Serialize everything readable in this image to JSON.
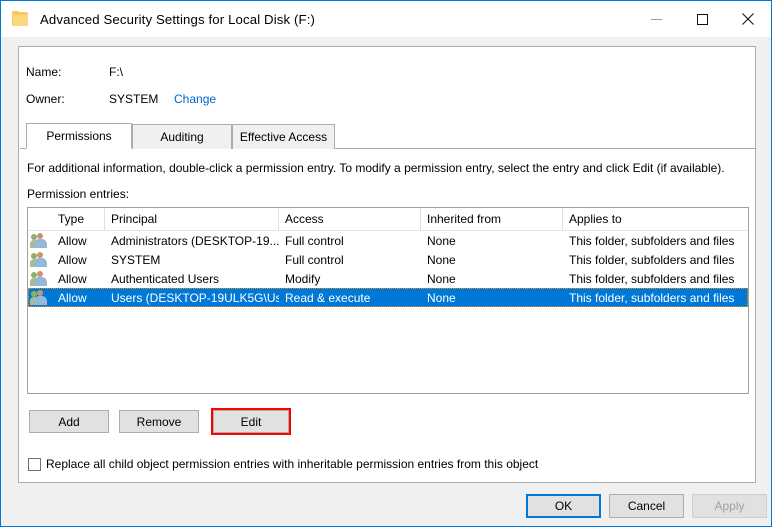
{
  "window": {
    "title": "Advanced Security Settings for Local Disk (F:)",
    "icon": "folder-icon",
    "minimize_label": "–",
    "maximize_label": "□",
    "close_label": "✕"
  },
  "info": {
    "name_label": "Name:",
    "name_value": "F:\\",
    "owner_label": "Owner:",
    "owner_value": "SYSTEM",
    "owner_change_link": "Change"
  },
  "tabs": [
    {
      "label": "Permissions",
      "active": true
    },
    {
      "label": "Auditing",
      "active": false
    },
    {
      "label": "Effective Access",
      "active": false
    }
  ],
  "main": {
    "instruction": "For additional information, double-click a permission entry. To modify a permission entry, select the entry and click Edit (if available).",
    "entries_label": "Permission entries:"
  },
  "table": {
    "columns": [
      "Type",
      "Principal",
      "Access",
      "Inherited from",
      "Applies to"
    ],
    "rows": [
      {
        "icon": "group-user-icon",
        "type": "Allow",
        "principal": "Administrators (DESKTOP-19...",
        "access": "Full control",
        "inherited_from": "None",
        "applies_to": "This folder, subfolders and files",
        "selected": false
      },
      {
        "icon": "group-user-icon",
        "type": "Allow",
        "principal": "SYSTEM",
        "access": "Full control",
        "inherited_from": "None",
        "applies_to": "This folder, subfolders and files",
        "selected": false
      },
      {
        "icon": "group-user-icon",
        "type": "Allow",
        "principal": "Authenticated Users",
        "access": "Modify",
        "inherited_from": "None",
        "applies_to": "This folder, subfolders and files",
        "selected": false
      },
      {
        "icon": "group-user-icon",
        "type": "Allow",
        "principal": "Users (DESKTOP-19ULK5G\\Us...",
        "access": "Read & execute",
        "inherited_from": "None",
        "applies_to": "This folder, subfolders and files",
        "selected": true
      }
    ]
  },
  "entry_buttons": {
    "add": "Add",
    "remove": "Remove",
    "edit": "Edit"
  },
  "replace_checkbox": {
    "label": "Replace all child object permission entries with inheritable permission entries from this object",
    "checked": false
  },
  "footer_buttons": {
    "ok": "OK",
    "cancel": "Cancel",
    "apply": "Apply",
    "apply_disabled": true
  },
  "colors": {
    "accent": "#0078d7",
    "selection_bg": "#0078d7",
    "selection_fg": "#ffffff",
    "link": "#0066cc",
    "highlight_box": "#ff0000",
    "window_bg": "#f0f0f0",
    "panel_bg": "#ffffff"
  }
}
